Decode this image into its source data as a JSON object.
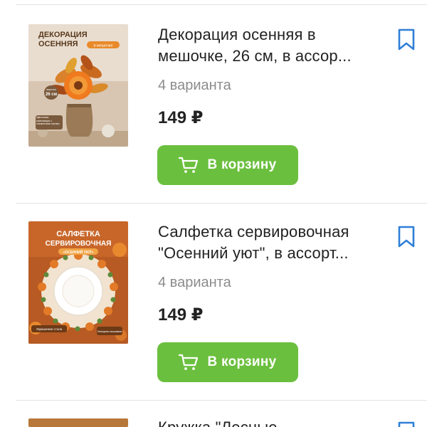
{
  "products": [
    {
      "title": "Декорация осенняя в мешочке, 26 см, в ассор...",
      "variants": "4 варианта",
      "price": "149 ₽",
      "cart_label": "В корзину",
      "image_text": {
        "line1": "ДЕКОРАЦИЯ",
        "line2": "ОСЕННЯЯ",
        "tag": "в мешочке",
        "size_top": "высота",
        "size_value": "26 см",
        "caption": "Цветочная композиция с элементами листвы"
      }
    },
    {
      "title": "Салфетка сервировочная \"Осенний уют\", в ассорт...",
      "variants": "4 варианта",
      "price": "149 ₽",
      "cart_label": "В корзину",
      "image_text": {
        "line1": "САЛФЕТКА",
        "line2": "СЕРВИРОВОЧНАЯ",
        "tag": "«ОСЕННИЙ УЮТ»",
        "badge_left": "Украшение стола",
        "badge_right": "Изящная вышивка"
      }
    },
    {
      "title": "Кружка \"Лесные..."
    }
  ],
  "colors": {
    "cart_button": "#6bbf3e",
    "bookmark": "#2f7fd8",
    "price_text": "#222222",
    "variants_text": "#8c8c8c"
  },
  "icons": {
    "cart": "cart-icon",
    "bookmark": "bookmark-icon"
  }
}
